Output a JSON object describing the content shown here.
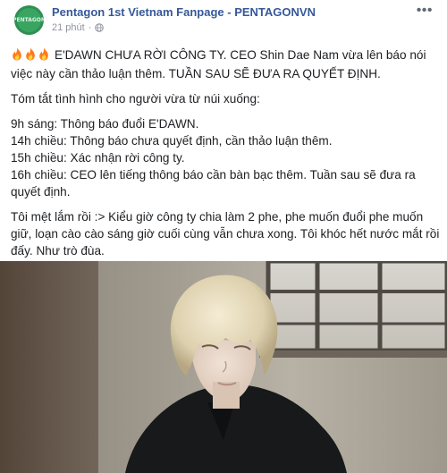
{
  "post": {
    "page_name": "Pentagon 1st Vietnam Fanpage - PENTAGONVN",
    "timestamp": "21 phút",
    "privacy_icon": "globe-icon",
    "more_icon": "more-options-icon",
    "avatar_text": "PENTAGON",
    "headline": "E'DAWN CHƯA RỜI CÔNG TY. CEO Shin Dae Nam vừa lên báo nói việc này cần thảo luận thêm. TUẦN SAU SẼ ĐƯA RA QUYẾT ĐỊNH.",
    "summary_intro": "Tóm tắt tình hình cho người vừa từ núi xuống:",
    "timeline": [
      "9h sáng: Thông báo đuổi E'DAWN.",
      "14h chiều: Thông báo chưa quyết định, cần thảo luận thêm.",
      "15h chiều: Xác nhận rời công ty.",
      "16h chiều: CEO lên tiếng thông báo cần bàn bạc thêm. Tuần sau sẽ đưa ra quyết định."
    ],
    "closing": "Tôi mệt lắm rồi :> Kiểu giờ công ty chia làm 2 phe, phe muốn đuổi phe muốn giữ, loạn cào cào sáng giờ cuối cùng vẫn chưa xong. Tôi khóc hết nước mắt rồi đấy. Như trò đùa."
  },
  "colors": {
    "link_blue": "#365899",
    "meta_gray": "#90949c",
    "text": "#1c1e21"
  }
}
